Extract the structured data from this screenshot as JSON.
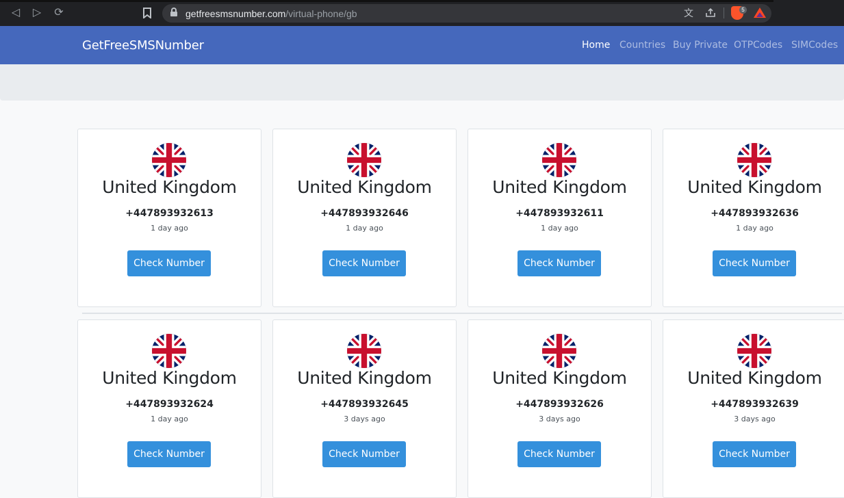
{
  "browser": {
    "url_domain": "getfreesmsnumber.com",
    "url_path": "/virtual-phone/gb",
    "brave_badge": "5"
  },
  "navbar": {
    "brand": "GetFreeSMSNumber",
    "links": [
      {
        "label": "Home",
        "active": true
      },
      {
        "label": "Countries",
        "active": false
      },
      {
        "label": "Buy Private",
        "active": false
      },
      {
        "label": "OTPCodes",
        "active": false
      },
      {
        "label": "SIMCodes",
        "active": false
      }
    ]
  },
  "cards": [
    {
      "country": "United Kingdom",
      "number": "+447893932613",
      "ago": "1 day ago",
      "button": "Check Number"
    },
    {
      "country": "United Kingdom",
      "number": "+447893932646",
      "ago": "1 day ago",
      "button": "Check Number"
    },
    {
      "country": "United Kingdom",
      "number": "+447893932611",
      "ago": "1 day ago",
      "button": "Check Number"
    },
    {
      "country": "United Kingdom",
      "number": "+447893932636",
      "ago": "1 day ago",
      "button": "Check Number"
    },
    {
      "country": "United Kingdom",
      "number": "+447893932624",
      "ago": "1 day ago",
      "button": "Check Number"
    },
    {
      "country": "United Kingdom",
      "number": "+447893932645",
      "ago": "3 days ago",
      "button": "Check Number"
    },
    {
      "country": "United Kingdom",
      "number": "+447893932626",
      "ago": "3 days ago",
      "button": "Check Number"
    },
    {
      "country": "United Kingdom",
      "number": "+447893932639",
      "ago": "3 days ago",
      "button": "Check Number"
    }
  ],
  "colors": {
    "navbar": "#4568bc",
    "button": "#3490dc",
    "flag_blue": "#012169",
    "flag_red": "#C8102E"
  }
}
